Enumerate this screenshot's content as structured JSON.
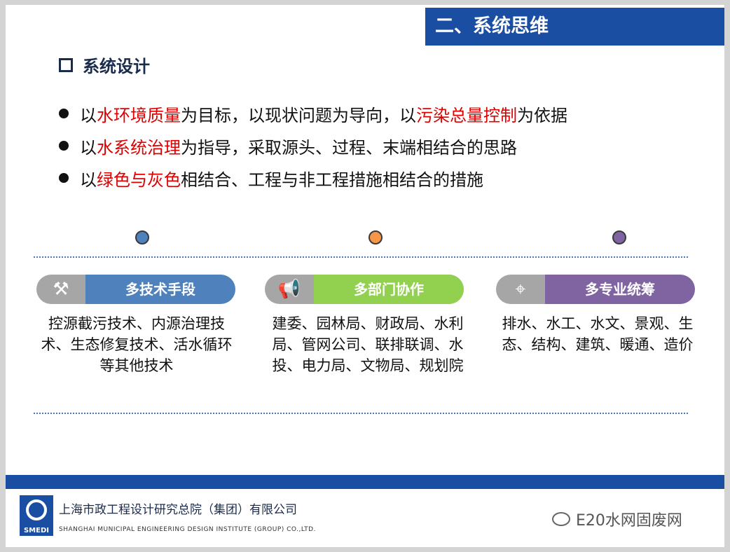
{
  "title": "二、系统思维",
  "section": "系统设计",
  "bullets": [
    [
      {
        "t": "以",
        "h": false
      },
      {
        "t": "水环境质量",
        "h": true
      },
      {
        "t": "为目标，以现状问题为导向，以",
        "h": false
      },
      {
        "t": "污染总量控制",
        "h": true
      },
      {
        "t": "为依据",
        "h": false
      }
    ],
    [
      {
        "t": "以",
        "h": false
      },
      {
        "t": "水系统治理",
        "h": true
      },
      {
        "t": "为指导，采取源头、过程、末端相结合的思路",
        "h": false
      }
    ],
    [
      {
        "t": "以",
        "h": false
      },
      {
        "t": "绿色与灰色",
        "h": true
      },
      {
        "t": "相结合、工程与非工程措施相结合的措施",
        "h": false
      }
    ]
  ],
  "colors": {
    "title_bar": "#1a4ea2",
    "highlight": "#e00000",
    "blue": "#4f81bd",
    "green": "#92d050",
    "purple": "#8064a2",
    "orange": "#f79646"
  },
  "cards": [
    {
      "icon": "tools-icon",
      "label": "多技术手段",
      "description": "控源截污技术、内源治理技术、生态修复技术、活水循环等其他技术"
    },
    {
      "icon": "megaphone-icon",
      "label": "多部门协作",
      "description": "建委、园林局、财政局、水利局、管网公司、联排联调、水投、电力局、文物局、规划院"
    },
    {
      "icon": "target-icon",
      "label": "多专业统筹",
      "description": "排水、水工、水文、景观、生态、结构、建筑、暖通、造价"
    }
  ],
  "footer": {
    "org_cn": "上海市政工程设计研究总院（集团）有限公司",
    "org_en": "SHANGHAI MUNICIPAL ENGINEERING DESIGN INSTITUTE (GROUP) CO.,LTD.",
    "logo_text": "SMEDI",
    "watermark": "E20水网固废网"
  }
}
